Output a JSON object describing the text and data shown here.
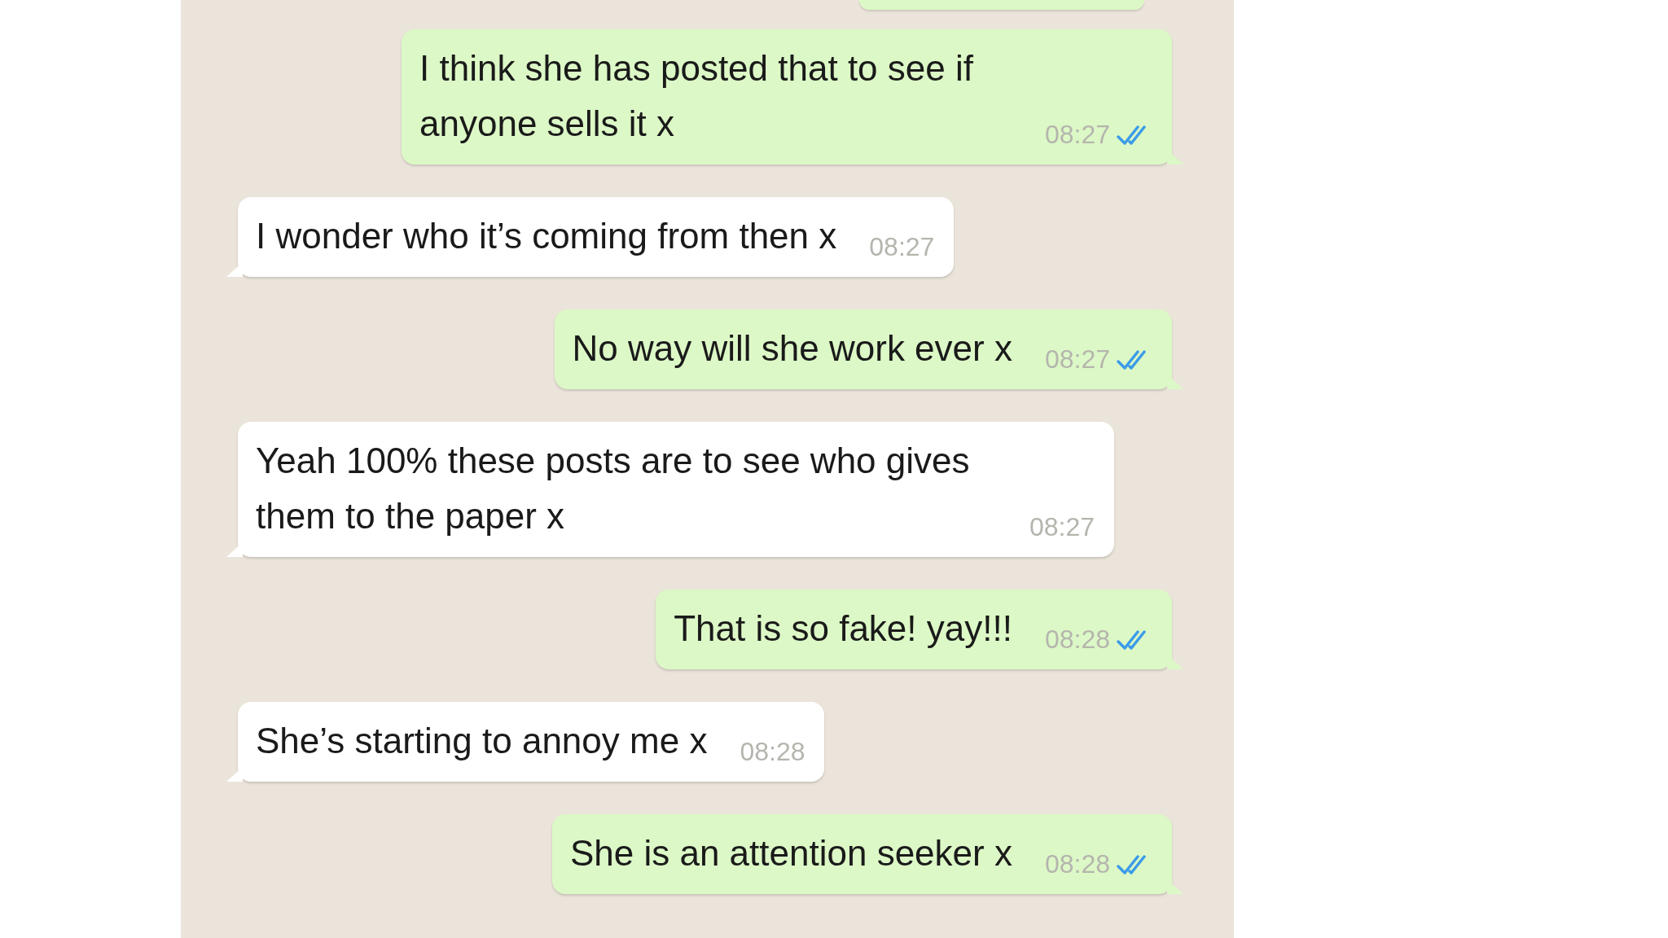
{
  "messages": [
    {
      "kind": "outgoing",
      "text": "I think she has posted that to see if anyone sells it x",
      "time": "08:27",
      "read": true
    },
    {
      "kind": "incoming",
      "text": "I wonder who it’s coming from then x",
      "time": "08:27"
    },
    {
      "kind": "outgoing",
      "text": "No way will she work ever x",
      "time": "08:27",
      "read": true
    },
    {
      "kind": "incoming",
      "text": "Yeah 100% these posts are to see who gives them to the paper x",
      "time": "08:27"
    },
    {
      "kind": "outgoing",
      "text": "That is so fake! yay!!!",
      "time": "08:28",
      "read": true
    },
    {
      "kind": "incoming",
      "text": "She’s starting to annoy me x",
      "time": "08:28"
    },
    {
      "kind": "outgoing",
      "text": "She is an attention seeker x",
      "time": "08:28",
      "read": true
    }
  ]
}
